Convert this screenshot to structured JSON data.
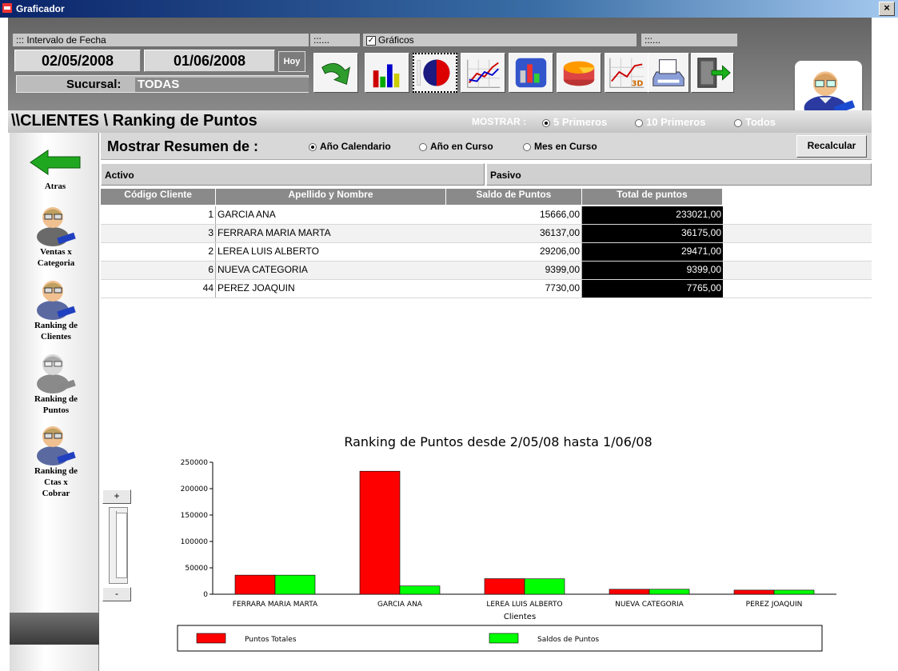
{
  "window": {
    "title": "Graficador",
    "close_label": "×"
  },
  "filters": {
    "date_range_label": "::: Intervalo de Fecha",
    "date_from": "02/05/2008",
    "date_to": "01/06/2008",
    "today_button": "Hoy",
    "branch_label": "Sucursal:",
    "branch_value": "TODAS",
    "actions_group_label": ":::...",
    "charts_group_label": "Gráficos",
    "charts_checked": true,
    "misc_group_label": ":::..."
  },
  "toolbar_icons": [
    "refresh-arrow-icon",
    "bar-chart-icon",
    "pie-chart-icon",
    "line-chart-icon",
    "3d-bar-chart-icon",
    "3d-pie-chart-icon",
    "3d-line-chart-icon",
    "print-icon",
    "exit-door-icon"
  ],
  "breadcrumb": "\\\\CLIENTES \\ Ranking de Puntos",
  "show": {
    "label": "MOSTRAR :",
    "options": [
      "5 Primeros",
      "10 Primeros",
      "Todos"
    ],
    "selected": "5 Primeros"
  },
  "summary": {
    "label": "Mostrar Resumen de :",
    "options": [
      "Año Calendario",
      "Año en Curso",
      "Mes en Curso"
    ],
    "selected": "Año Calendario",
    "recalc_button": "Recalcular"
  },
  "tabs": {
    "active": "Activo",
    "passive": "Pasivo"
  },
  "sidebar": {
    "back_label": "Atras",
    "items": [
      {
        "label_lines": [
          "Ventas x",
          "Categoria"
        ]
      },
      {
        "label_lines": [
          "Ranking de",
          "Clientes"
        ]
      },
      {
        "label_lines": [
          "Ranking de",
          "Puntos"
        ]
      },
      {
        "label_lines": [
          "Ranking de",
          "Ctas x",
          "Cobrar"
        ]
      }
    ]
  },
  "table": {
    "headers": [
      "Código Cliente",
      "Apellido y Nombre",
      "Saldo de Puntos",
      "Total de puntos"
    ],
    "rows": [
      [
        "1",
        "GARCIA ANA",
        "15666,00",
        "233021,00"
      ],
      [
        "3",
        "FERRARA MARIA MARTA",
        "36137,00",
        "36175,00"
      ],
      [
        "2",
        "LEREA LUIS ALBERTO",
        "29206,00",
        "29471,00"
      ],
      [
        "6",
        "NUEVA CATEGORIA",
        "9399,00",
        "9399,00"
      ],
      [
        "44",
        "PEREZ JOAQUIN",
        "7730,00",
        "7765,00"
      ]
    ]
  },
  "zoom": {
    "plus": "+",
    "minus": "-"
  },
  "chart_data": {
    "type": "bar",
    "title": "Ranking de Puntos desde 2/05/08  hasta 1/06/08",
    "xlabel": "Clientes",
    "ylabel": "",
    "categories": [
      "FERRARA MARIA MARTA",
      "GARCIA ANA",
      "LEREA LUIS ALBERTO",
      "NUEVA CATEGORIA",
      "PEREZ JOAQUIN"
    ],
    "series": [
      {
        "name": "Puntos Totales",
        "color": "#ff0000",
        "values": [
          36175,
          233021,
          29471,
          9399,
          7765
        ]
      },
      {
        "name": "Saldos de Puntos",
        "color": "#00ff00",
        "values": [
          36137,
          15666,
          29206,
          9399,
          7730
        ]
      }
    ],
    "ylim": [
      0,
      250000
    ],
    "yticks": [
      0,
      50000,
      100000,
      150000,
      200000,
      250000
    ],
    "legend": "bottom",
    "grid": false
  }
}
